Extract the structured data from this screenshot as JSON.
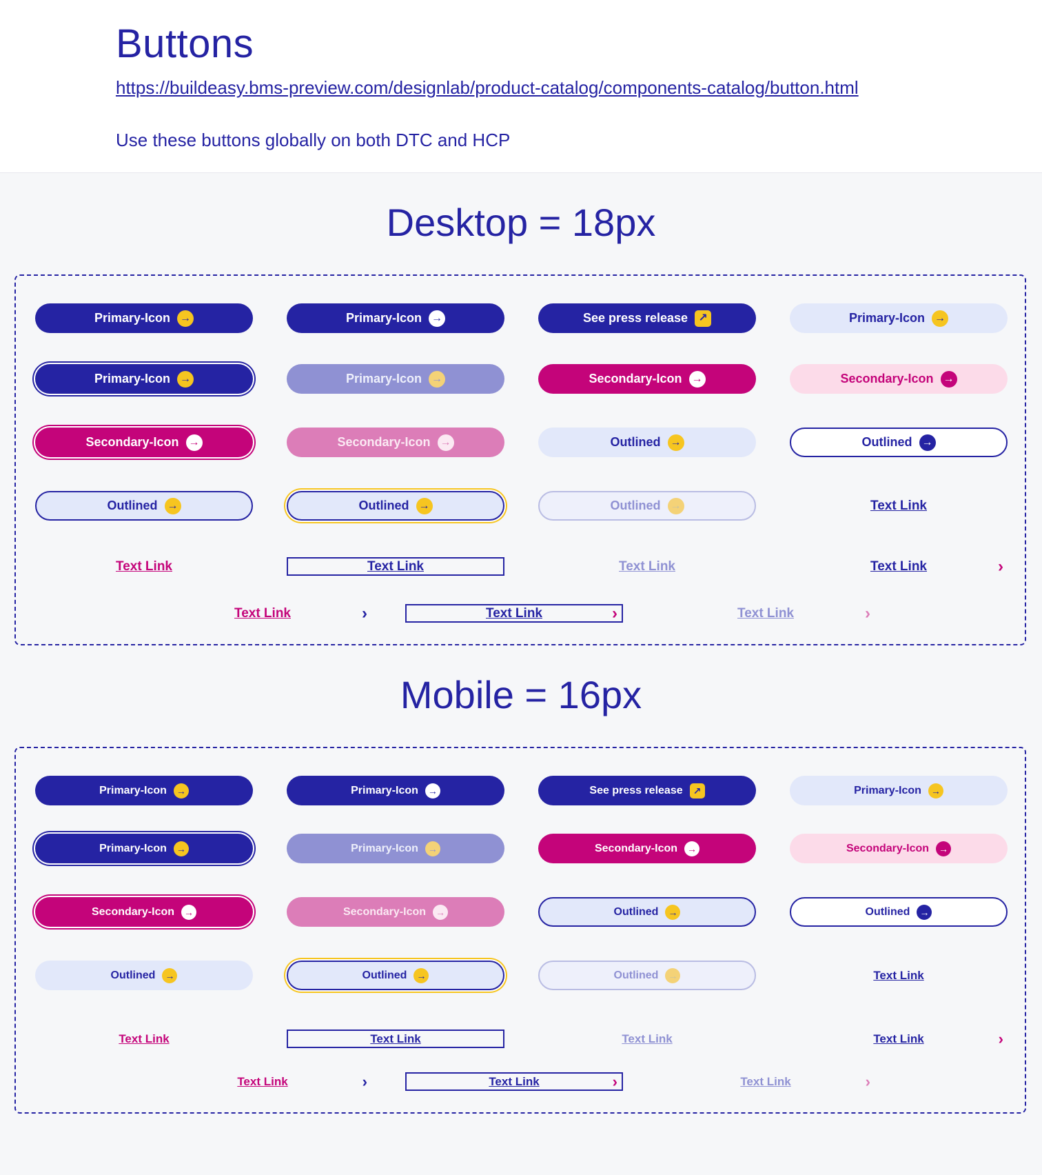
{
  "header": {
    "title": "Buttons",
    "url": "https://buildeasy.bms-preview.com/designlab/product-catalog/components-catalog/button.html",
    "description": "Use these buttons globally on both DTC and HCP"
  },
  "colors": {
    "navy": "#2523a3",
    "navy_muted": "#8f91d3",
    "magenta": "#c4047a",
    "magenta_muted": "#dc7db8",
    "pale_blue": "#e2e8fa",
    "pale_pink": "#fcdbe9",
    "yellow": "#f6c520",
    "white": "#ffffff"
  },
  "icons": {
    "arrow": "arrow-right-circle-icon",
    "external": "external-link-icon",
    "chevron": "chevron-right-icon"
  },
  "sections": [
    {
      "title": "Desktop = 18px",
      "font_size": 18,
      "items": [
        {
          "kind": "button",
          "label": "Primary-Icon",
          "variant": "primary-yellow-icon"
        },
        {
          "kind": "button",
          "label": "Primary-Icon",
          "variant": "primary-white-icon"
        },
        {
          "kind": "button",
          "label": "See press release",
          "variant": "primary-external-icon"
        },
        {
          "kind": "button",
          "label": "Primary-Icon",
          "variant": "primary-light"
        },
        {
          "kind": "button",
          "label": "Primary-Icon",
          "variant": "primary-focus"
        },
        {
          "kind": "button",
          "label": "Primary-Icon",
          "variant": "primary-disabled"
        },
        {
          "kind": "button",
          "label": "Secondary-Icon",
          "variant": "secondary"
        },
        {
          "kind": "button",
          "label": "Secondary-Icon",
          "variant": "secondary-light"
        },
        {
          "kind": "button",
          "label": "Secondary-Icon",
          "variant": "secondary-focus"
        },
        {
          "kind": "button",
          "label": "Secondary-Icon",
          "variant": "secondary-disabled"
        },
        {
          "kind": "button",
          "label": "Outlined",
          "variant": "outlined-light"
        },
        {
          "kind": "button",
          "label": "Outlined",
          "variant": "outlined-white"
        },
        {
          "kind": "button",
          "label": "Outlined",
          "variant": "outlined-filled"
        },
        {
          "kind": "button",
          "label": "Outlined",
          "variant": "outlined-focus"
        },
        {
          "kind": "button",
          "label": "Outlined",
          "variant": "outlined-disabled"
        },
        {
          "kind": "link",
          "label": "Text Link",
          "variant": "navy"
        },
        {
          "kind": "link",
          "label": "Text Link",
          "variant": "magenta"
        },
        {
          "kind": "link",
          "label": "Text Link",
          "variant": "navy-boxed"
        },
        {
          "kind": "link",
          "label": "Text Link",
          "variant": "muted"
        },
        {
          "kind": "link",
          "label": "Text Link",
          "variant": "navy-chevron"
        },
        {
          "kind": "link",
          "label": "Text Link",
          "variant": "magenta-chevron"
        },
        {
          "kind": "link",
          "label": "Text Link",
          "variant": "navy-boxed-chevron"
        },
        {
          "kind": "link",
          "label": "Text Link",
          "variant": "muted-chevron"
        }
      ]
    },
    {
      "title": "Mobile = 16px",
      "font_size": 16,
      "items": [
        {
          "kind": "button",
          "label": "Primary-Icon",
          "variant": "primary-yellow-icon"
        },
        {
          "kind": "button",
          "label": "Primary-Icon",
          "variant": "primary-white-icon"
        },
        {
          "kind": "button",
          "label": "See press release",
          "variant": "primary-external-icon"
        },
        {
          "kind": "button",
          "label": "Primary-Icon",
          "variant": "primary-light"
        },
        {
          "kind": "button",
          "label": "Primary-Icon",
          "variant": "primary-focus"
        },
        {
          "kind": "button",
          "label": "Primary-Icon",
          "variant": "primary-disabled"
        },
        {
          "kind": "button",
          "label": "Secondary-Icon",
          "variant": "secondary"
        },
        {
          "kind": "button",
          "label": "Secondary-Icon",
          "variant": "secondary-light"
        },
        {
          "kind": "button",
          "label": "Secondary-Icon",
          "variant": "secondary-focus"
        },
        {
          "kind": "button",
          "label": "Secondary-Icon",
          "variant": "secondary-disabled"
        },
        {
          "kind": "button",
          "label": "Outlined",
          "variant": "outlined-filled"
        },
        {
          "kind": "button",
          "label": "Outlined",
          "variant": "outlined-white"
        },
        {
          "kind": "button",
          "label": "Outlined",
          "variant": "outlined-light"
        },
        {
          "kind": "button",
          "label": "Outlined",
          "variant": "outlined-focus"
        },
        {
          "kind": "button",
          "label": "Outlined",
          "variant": "outlined-disabled"
        },
        {
          "kind": "link",
          "label": "Text Link",
          "variant": "navy"
        },
        {
          "kind": "link",
          "label": "Text Link",
          "variant": "magenta"
        },
        {
          "kind": "link",
          "label": "Text Link",
          "variant": "navy-boxed"
        },
        {
          "kind": "link",
          "label": "Text Link",
          "variant": "muted"
        },
        {
          "kind": "link",
          "label": "Text Link",
          "variant": "navy-chevron"
        },
        {
          "kind": "link",
          "label": "Text Link",
          "variant": "magenta-chevron"
        },
        {
          "kind": "link",
          "label": "Text Link",
          "variant": "navy-boxed-chevron"
        },
        {
          "kind": "link",
          "label": "Text Link",
          "variant": "muted-chevron"
        }
      ]
    }
  ]
}
